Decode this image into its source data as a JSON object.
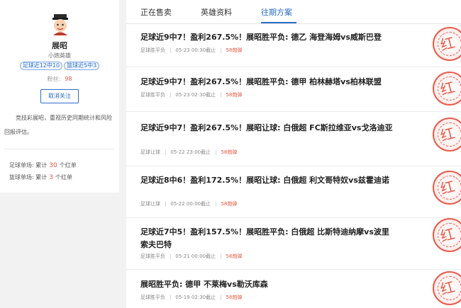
{
  "profile": {
    "name": "展昭",
    "title": "小炮英雄",
    "tags": [
      "足球近12中10",
      "篮球近5中3"
    ],
    "fans_label": "粉丝:",
    "fans_count": "98",
    "unfollow_label": "取消关注",
    "bio": "竞技彩展昭，重视历史同期统计和风险回报评估。",
    "stats": [
      {
        "label": "足球单场:",
        "prefix": "累计",
        "value": "30",
        "suffix": "个红单"
      },
      {
        "label": "篮球单场:",
        "prefix": "累计",
        "value": "3",
        "suffix": "个红单"
      }
    ]
  },
  "tabs": [
    {
      "label": "正在售卖",
      "active": false
    },
    {
      "label": "英雄资料",
      "active": false
    },
    {
      "label": "往期方案",
      "active": true
    }
  ],
  "items": [
    {
      "title": "足球近9中7！盈利267.5%！展昭胜平负: 德乙 海登海姆vs威斯巴登",
      "type": "足球胜平负",
      "time": "05-23 00:30截止",
      "price": "58炮弹",
      "stamp": "红"
    },
    {
      "title": "足球近9中7！盈利267.5%！展昭胜平负: 德甲 柏林赫塔vs柏林联盟",
      "type": "足球胜平负",
      "time": "05-23 02:30截止",
      "price": "58炮弹",
      "stamp": "红"
    },
    {
      "title": "足球近9中7！盈利267.5%！展昭让球: 白俄超 FC斯拉维亚vs戈洛迪亚",
      "type": "足球让球",
      "time": "05-22 23:00截止",
      "price": "58炮弹",
      "stamp": "红"
    },
    {
      "title": "足球近8中6！盈利172.5%！展昭让球: 白俄超 利文哥特奴vs兹霍迪诺",
      "type": "足球让球",
      "time": "05-22 00:00截止",
      "price": "58炮弹",
      "stamp": "红"
    },
    {
      "title": "足球近7中5！盈利157.5%！展昭胜平负: 白俄超 比斯特迪纳摩vs波里索夫巴特",
      "type": "足球胜平负",
      "time": "05-21 00:00截止",
      "price": "58炮弹",
      "stamp": "红"
    },
    {
      "title": "展昭胜平负: 德甲 不莱梅vs勒沃库森",
      "type": "足球胜平负",
      "time": "05-19 02:30截止",
      "price": "58炮弹",
      "stamp": "红"
    }
  ],
  "colors": {
    "accent": "#2a6dc9",
    "price": "#e8563f",
    "stamp": "#e85a4a"
  }
}
